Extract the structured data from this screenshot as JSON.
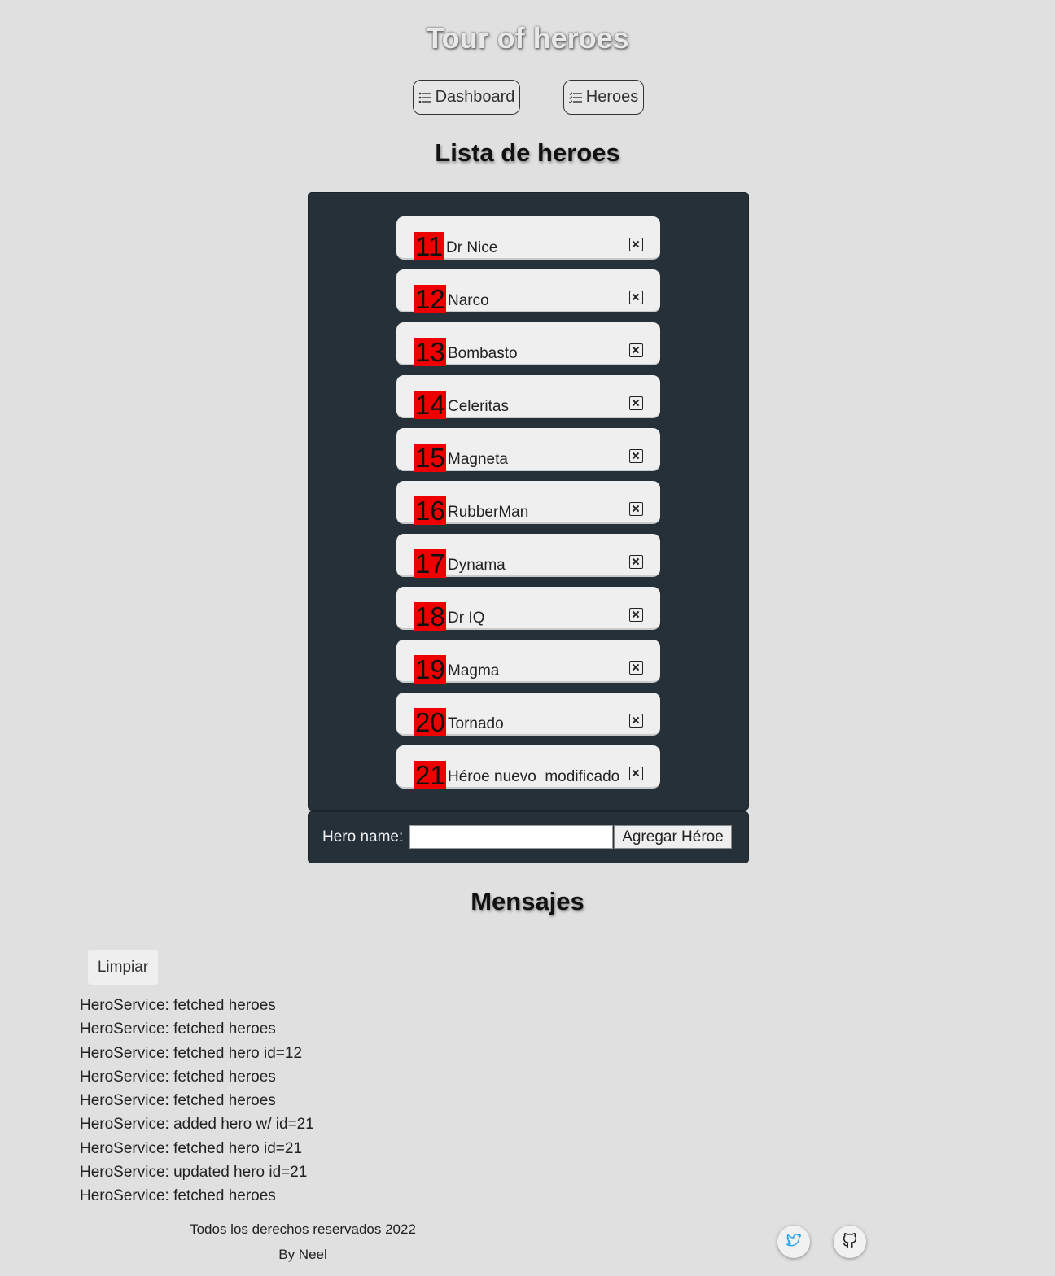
{
  "app_title": "Tour of heroes",
  "nav": {
    "dashboard_label": "Dashboard",
    "heroes_label": "Heroes"
  },
  "hero_list_title": "Lista de heroes",
  "heroes": [
    {
      "id": "11",
      "name": "Dr Nice"
    },
    {
      "id": "12",
      "name": "Narco"
    },
    {
      "id": "13",
      "name": "Bombasto"
    },
    {
      "id": "14",
      "name": "Celeritas"
    },
    {
      "id": "15",
      "name": "Magneta"
    },
    {
      "id": "16",
      "name": "RubberMan"
    },
    {
      "id": "17",
      "name": "Dynama"
    },
    {
      "id": "18",
      "name": "Dr IQ"
    },
    {
      "id": "19",
      "name": "Magma"
    },
    {
      "id": "20",
      "name": "Tornado"
    },
    {
      "id": "21",
      "name": "Héroe nuevo  modificado"
    }
  ],
  "add_hero": {
    "label": "Hero name:",
    "input_value": "",
    "button_label": "Agregar Héroe"
  },
  "messages_title": "Mensajes",
  "clear_button_label": "Limpiar",
  "messages": [
    "HeroService: fetched heroes",
    "HeroService: fetched heroes",
    "HeroService: fetched hero id=12",
    "HeroService: fetched heroes",
    "HeroService: fetched heroes",
    "HeroService: added hero w/ id=21",
    "HeroService: fetched hero id=21",
    "HeroService: updated hero id=21",
    "HeroService: fetched heroes"
  ],
  "footer": {
    "rights": "Todos los derechos reservados 2022",
    "author": "By Neel"
  },
  "social": [
    {
      "icon": "twitter-icon",
      "color": "#1da1f2"
    },
    {
      "icon": "github-icon",
      "color": "#222222"
    }
  ],
  "colors": {
    "background": "#e0e0e0",
    "panel": "#263038",
    "hero_id_badge": "#ee0000"
  }
}
